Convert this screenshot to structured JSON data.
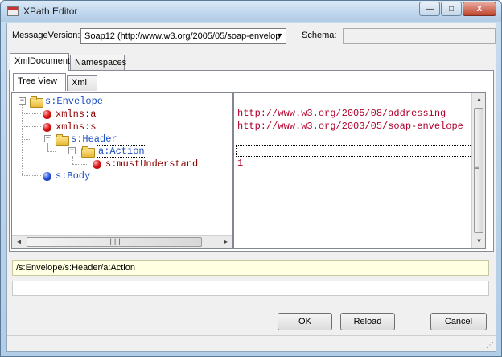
{
  "window": {
    "title": "XPath Editor",
    "minimize": "—",
    "maximize": "□",
    "close": "X"
  },
  "top": {
    "message_version_label": "MessageVersion:",
    "message_version_value": "Soap12 (http://www.w3.org/2005/05/soap-envelop",
    "schema_label": "Schema:",
    "schema_value": ""
  },
  "outer_tabs": [
    "XmlDocument",
    "Namespaces"
  ],
  "inner_tabs": [
    "Tree View",
    "Xml"
  ],
  "tree": {
    "nodes": [
      {
        "label": "s:Envelope",
        "kind": "folder"
      },
      {
        "label": "xmlns:a",
        "kind": "attr"
      },
      {
        "label": "xmlns:s",
        "kind": "attr"
      },
      {
        "label": "s:Header",
        "kind": "folder"
      },
      {
        "label": "a:Action",
        "kind": "folder",
        "selected": true
      },
      {
        "label": "s:mustUnderstand",
        "kind": "attr"
      },
      {
        "label": "s:Body",
        "kind": "element"
      }
    ],
    "values": [
      "",
      "http://www.w3.org/2005/08/addressing",
      "http://www.w3.org/2003/05/soap-envelope",
      "",
      "",
      "1",
      ""
    ]
  },
  "xpath": "/s:Envelope/s:Header/a:Action",
  "buttons": {
    "ok": "OK",
    "reload": "Reload",
    "cancel": "Cancel"
  },
  "colors": {
    "element_text": "#1a4fbf",
    "attr_text": "#8b0000",
    "value_text": "#b0002c",
    "xpath_bg": "#ffffe1"
  }
}
